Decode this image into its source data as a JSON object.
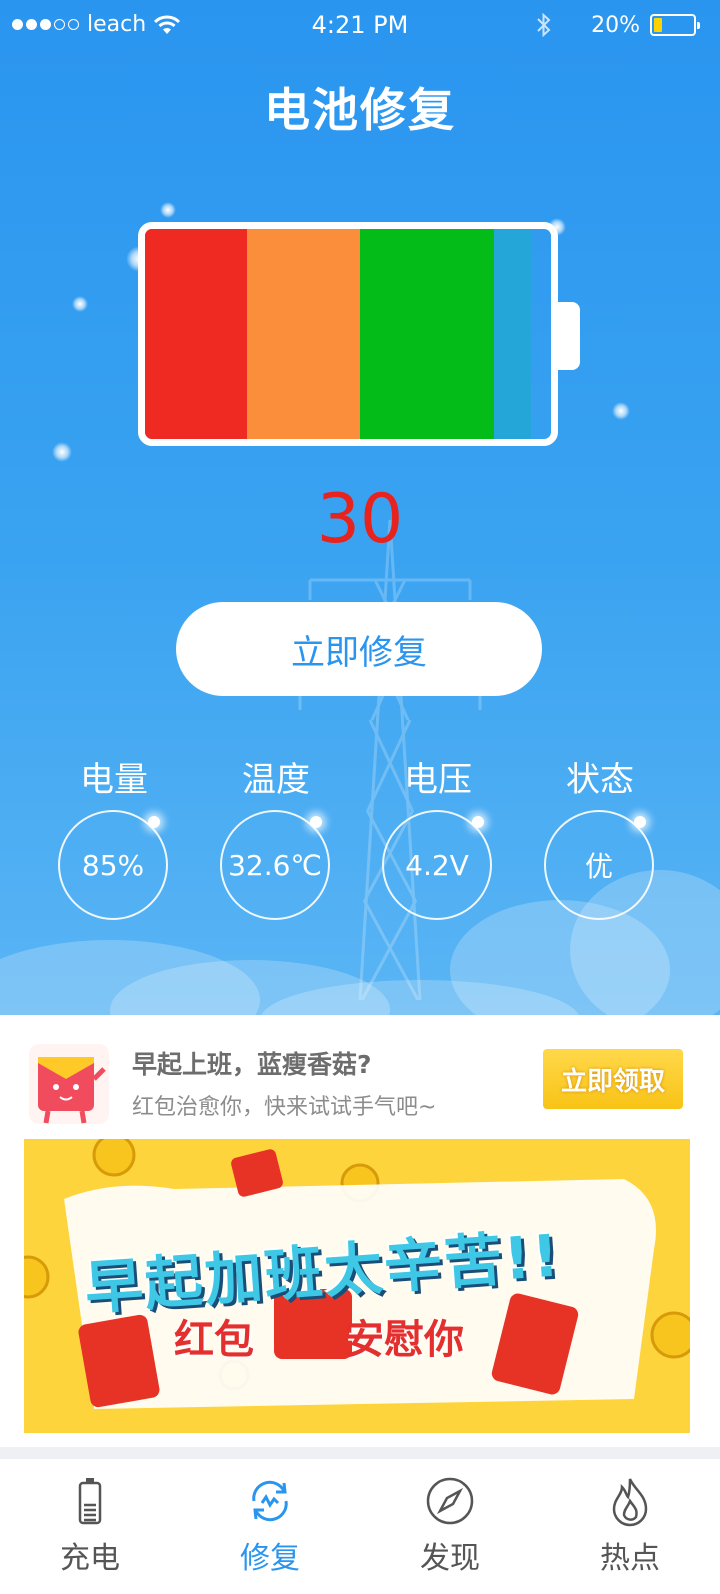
{
  "status_bar": {
    "carrier": "leach",
    "time": "4:21 PM",
    "battery_percent": "20%",
    "signal_bars_filled": 3,
    "signal_bars_total": 5,
    "battery_level": 0.2
  },
  "header": {
    "title": "电池修复"
  },
  "battery": {
    "segments": [
      {
        "color": "#ef2a22",
        "fraction": 0.25
      },
      {
        "color": "#fb8e3a",
        "fraction": 0.28
      },
      {
        "color": "#03bc17",
        "fraction": 0.33
      },
      {
        "color": "#24a6d8",
        "fraction": 0.09
      }
    ],
    "level": "30"
  },
  "repair_button": {
    "label": "立即修复"
  },
  "stats": [
    {
      "label": "电量",
      "value": "85%"
    },
    {
      "label": "温度",
      "value": "32.6℃"
    },
    {
      "label": "电压",
      "value": "4.2V"
    },
    {
      "label": "状态",
      "value": "优"
    }
  ],
  "promo": {
    "title": "早起上班，蓝瘦香菇?",
    "subtitle": "红包治愈你，快来试试手气吧~",
    "claim_label": "立即领取",
    "banner_line1": "早起加班太辛苦!!",
    "banner_line2_a": "红包",
    "banner_line2_b": "安慰你"
  },
  "tabs": [
    {
      "label": "充电",
      "icon": "battery-icon",
      "active": false
    },
    {
      "label": "修复",
      "icon": "repair-icon",
      "active": true
    },
    {
      "label": "发现",
      "icon": "compass-icon",
      "active": false
    },
    {
      "label": "热点",
      "icon": "flame-icon",
      "active": false
    }
  ],
  "colors": {
    "primary": "#2a95ef",
    "level_text": "#e8231d",
    "banner_bg": "#fdd43b"
  }
}
